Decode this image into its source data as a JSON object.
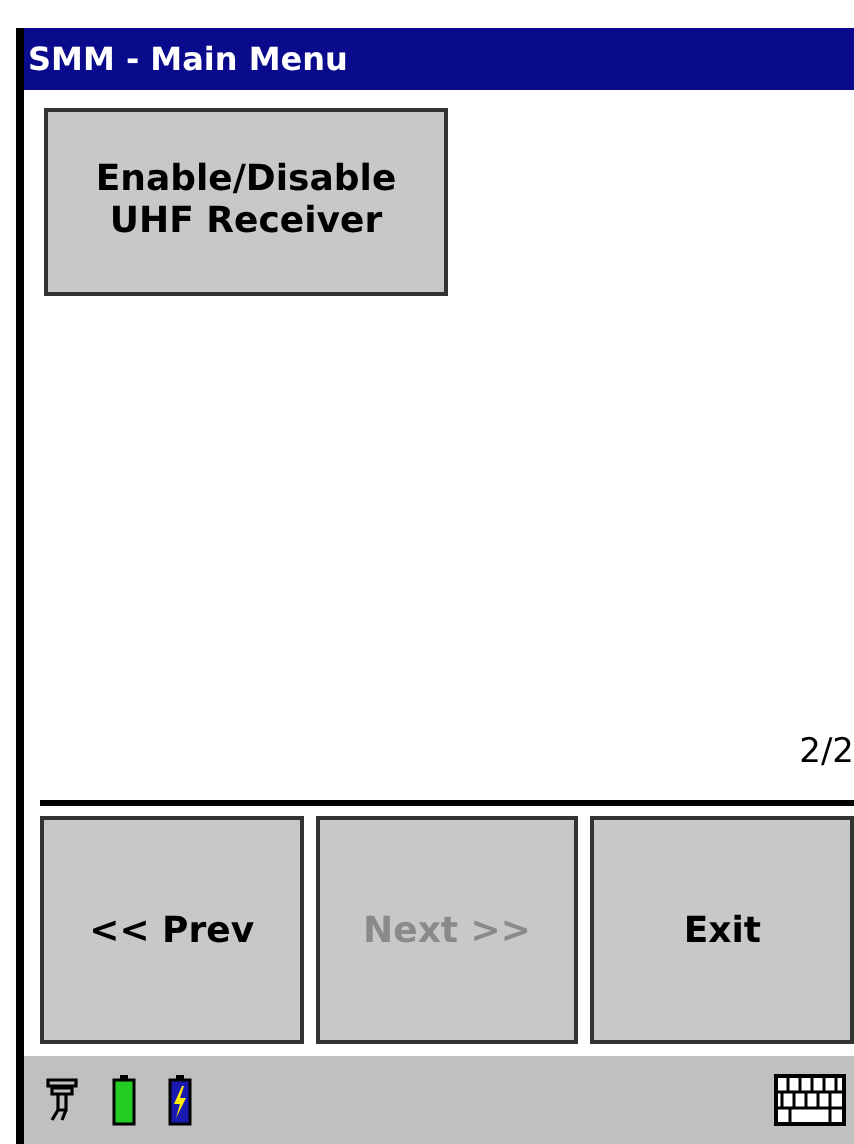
{
  "window": {
    "title": "SMM - Main Menu"
  },
  "menu_buttons": [
    {
      "label": "Enable/Disable\nUHF Receiver",
      "disabled": false
    }
  ],
  "page_indicator": "2/2",
  "nav_buttons": [
    {
      "label": "<< Prev",
      "disabled": false
    },
    {
      "label": "Next >>",
      "disabled": true
    },
    {
      "label": "Exit",
      "disabled": false
    }
  ]
}
